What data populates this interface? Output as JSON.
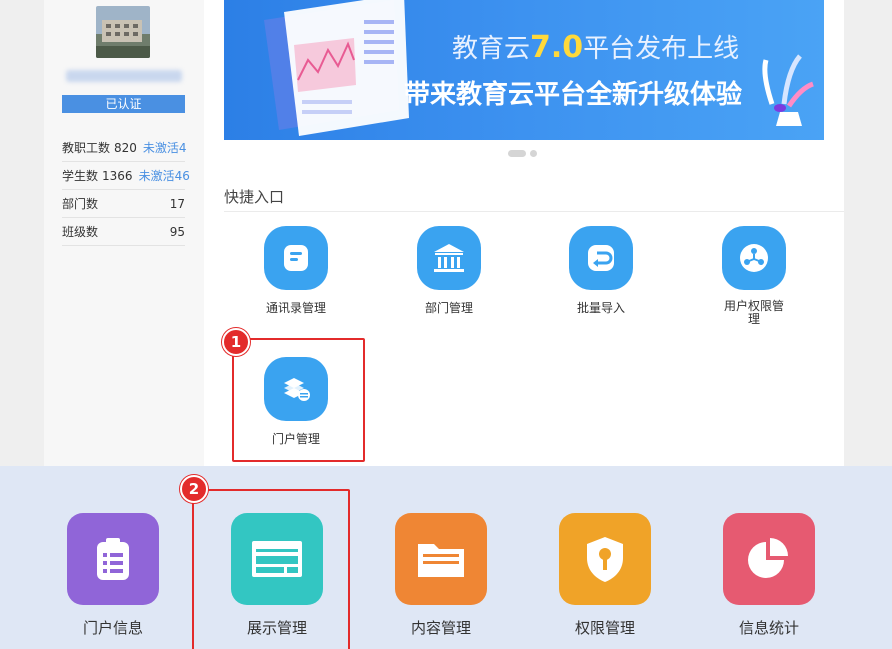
{
  "sidebar": {
    "badge": "已认证",
    "stats": [
      {
        "label": "教职工数",
        "value": "820",
        "link": "未激活4"
      },
      {
        "label": "学生数",
        "value": "1366",
        "link": "未激活46"
      },
      {
        "label": "部门数",
        "value": "17"
      },
      {
        "label": "班级数",
        "value": "95"
      }
    ]
  },
  "banner": {
    "line1_prefix": "教育云",
    "line1_version": "7.0",
    "line1_suffix": "平台发布上线",
    "line2": "带来教育云平台全新升级体验"
  },
  "quick_entry": {
    "title": "快捷入口",
    "items": [
      {
        "label": "通讯录管理",
        "icon": "contacts-icon"
      },
      {
        "label": "部门管理",
        "icon": "building-icon"
      },
      {
        "label": "批量导入",
        "icon": "import-icon"
      },
      {
        "label": "用户权限管理",
        "icon": "permission-network-icon"
      },
      {
        "label": "门户管理",
        "icon": "layers-icon"
      }
    ]
  },
  "steps": [
    "1",
    "2"
  ],
  "portal_menu": {
    "tiles": [
      {
        "label": "门户信息",
        "icon": "clipboard-list-icon",
        "color": "#9065d8"
      },
      {
        "label": "展示管理",
        "icon": "layout-icon",
        "color": "#33c6c2"
      },
      {
        "label": "内容管理",
        "icon": "folder-icon",
        "color": "#ef8634"
      },
      {
        "label": "权限管理",
        "icon": "shield-key-icon",
        "color": "#f0a328"
      },
      {
        "label": "信息统计",
        "icon": "pie-chart-icon",
        "color": "#e65a71"
      }
    ]
  },
  "colors": {
    "accent": "#4a90e2",
    "highlight": "#e32b2b",
    "quick_icon": "#3aa3f0"
  }
}
